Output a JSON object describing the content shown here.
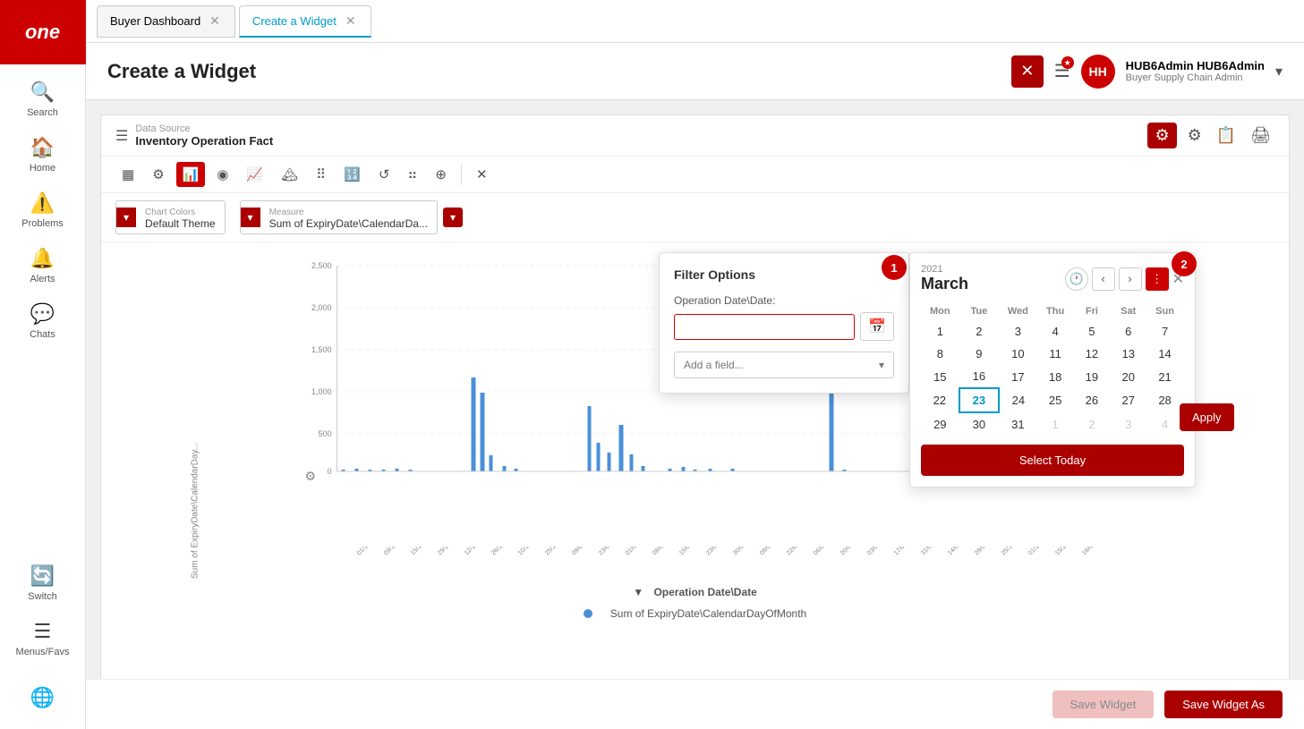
{
  "app": {
    "logo": "one",
    "logo_label": "one"
  },
  "sidebar": {
    "items": [
      {
        "id": "search",
        "label": "Search",
        "icon": "🔍"
      },
      {
        "id": "home",
        "label": "Home",
        "icon": "🏠"
      },
      {
        "id": "problems",
        "label": "Problems",
        "icon": "⚠️"
      },
      {
        "id": "alerts",
        "label": "Alerts",
        "icon": "🔔"
      },
      {
        "id": "chats",
        "label": "Chats",
        "icon": "💬"
      },
      {
        "id": "switch",
        "label": "Switch",
        "icon": "🔄"
      },
      {
        "id": "menus",
        "label": "Menus/Favs",
        "icon": "☰"
      }
    ],
    "bottom_icon": "🌐"
  },
  "tabs": [
    {
      "id": "buyer-dashboard",
      "label": "Buyer Dashboard",
      "active": false
    },
    {
      "id": "create-widget",
      "label": "Create a Widget",
      "active": true
    }
  ],
  "header": {
    "title": "Create a Widget",
    "close_label": "✕",
    "menu_label": "☰",
    "user_initials": "HH",
    "user_name": "HUB6Admin HUB6Admin",
    "user_role": "Buyer Supply Chain Admin"
  },
  "datasource": {
    "label": "Data Source",
    "name": "Inventory Operation Fact"
  },
  "chart_tools": [
    {
      "id": "table",
      "icon": "▦",
      "active": false
    },
    {
      "id": "filter",
      "icon": "⚙",
      "active": false
    },
    {
      "id": "bar",
      "icon": "📊",
      "active": true
    },
    {
      "id": "pie",
      "icon": "●",
      "active": false
    },
    {
      "id": "line",
      "icon": "📈",
      "active": false
    },
    {
      "id": "area",
      "icon": "🏔",
      "active": false
    },
    {
      "id": "scatter",
      "icon": "⠿",
      "active": false
    },
    {
      "id": "stacked",
      "icon": "📉",
      "active": false
    },
    {
      "id": "refresh",
      "icon": "↺",
      "active": false
    },
    {
      "id": "dots",
      "icon": "⠶",
      "active": false
    },
    {
      "id": "pivot",
      "icon": "⊕",
      "active": false
    },
    {
      "id": "close",
      "icon": "✕",
      "active": false
    }
  ],
  "options": {
    "chart_colors_label": "Chart Colors",
    "chart_colors_value": "Default Theme",
    "measure_label": "Measure",
    "measure_value": "Sum of ExpiryDate\\CalendarDa..."
  },
  "filter_panel": {
    "title": "Filter Options",
    "field_label": "Operation Date\\Date:",
    "input_value": "",
    "input_placeholder": "",
    "add_field_label": "Add a field...",
    "badge1": "1",
    "badge2": "2"
  },
  "calendar": {
    "year": "2021",
    "month": "March",
    "days_header": [
      "Mon",
      "Tue",
      "Wed",
      "Thu",
      "Fri",
      "Sat",
      "Sun"
    ],
    "weeks": [
      [
        {
          "d": "1",
          "other": false
        },
        {
          "d": "2",
          "other": false
        },
        {
          "d": "3",
          "other": false
        },
        {
          "d": "4",
          "other": false
        },
        {
          "d": "5",
          "other": false
        },
        {
          "d": "6",
          "other": false
        },
        {
          "d": "7",
          "other": false
        }
      ],
      [
        {
          "d": "8",
          "other": false
        },
        {
          "d": "9",
          "other": false
        },
        {
          "d": "10",
          "other": false
        },
        {
          "d": "11",
          "other": false
        },
        {
          "d": "12",
          "other": false
        },
        {
          "d": "13",
          "other": false
        },
        {
          "d": "14",
          "other": false
        }
      ],
      [
        {
          "d": "15",
          "other": false
        },
        {
          "d": "16",
          "other": false
        },
        {
          "d": "17",
          "other": false
        },
        {
          "d": "18",
          "other": false
        },
        {
          "d": "19",
          "other": false
        },
        {
          "d": "20",
          "other": false
        },
        {
          "d": "21",
          "other": false
        }
      ],
      [
        {
          "d": "22",
          "other": false
        },
        {
          "d": "23",
          "today": true
        },
        {
          "d": "24",
          "other": false
        },
        {
          "d": "25",
          "other": false
        },
        {
          "d": "26",
          "other": false
        },
        {
          "d": "27",
          "other": false
        },
        {
          "d": "28",
          "other": false
        }
      ],
      [
        {
          "d": "29",
          "other": false
        },
        {
          "d": "30",
          "other": false
        },
        {
          "d": "31",
          "other": false
        },
        {
          "d": "1",
          "other": true
        },
        {
          "d": "2",
          "other": true
        },
        {
          "d": "3",
          "other": true
        },
        {
          "d": "4",
          "other": true
        }
      ]
    ],
    "select_today_label": "Select Today",
    "apply_label": "Apply"
  },
  "chart": {
    "y_label": "Sum of ExpiryDate\\CalendarDay...",
    "x_label": "Operation Date\\Date",
    "legend_label": "Sum of ExpiryDate\\CalendarDayOfMonth",
    "legend_color": "#4a90d9",
    "y_ticks": [
      "2,500",
      "2,000",
      "1,500",
      "1,000",
      "500",
      "0"
    ],
    "bars": [
      {
        "x": 0.08,
        "h": 0.02
      },
      {
        "x": 0.12,
        "h": 0.01
      },
      {
        "x": 0.16,
        "h": 0.01
      },
      {
        "x": 0.2,
        "h": 0.01
      },
      {
        "x": 0.25,
        "h": 0.01
      },
      {
        "x": 0.3,
        "h": 0.01
      },
      {
        "x": 0.35,
        "h": 0.395
      },
      {
        "x": 0.37,
        "h": 0.32
      },
      {
        "x": 0.39,
        "h": 0.07
      },
      {
        "x": 0.42,
        "h": 0.02
      },
      {
        "x": 0.45,
        "h": 0.02
      },
      {
        "x": 0.48,
        "h": 0.01
      },
      {
        "x": 0.52,
        "h": 0.27
      },
      {
        "x": 0.55,
        "h": 0.12
      },
      {
        "x": 0.57,
        "h": 0.08
      },
      {
        "x": 0.6,
        "h": 0.19
      },
      {
        "x": 0.62,
        "h": 0.07
      },
      {
        "x": 0.65,
        "h": 0.02
      },
      {
        "x": 0.68,
        "h": 0.01
      },
      {
        "x": 0.71,
        "h": 0.01
      },
      {
        "x": 0.74,
        "h": 0.01
      },
      {
        "x": 0.77,
        "h": 0.01
      },
      {
        "x": 0.8,
        "h": 0.92
      },
      {
        "x": 0.83,
        "h": 0.01
      }
    ]
  },
  "footer": {
    "save_label": "Save Widget",
    "save_as_label": "Save Widget As"
  }
}
